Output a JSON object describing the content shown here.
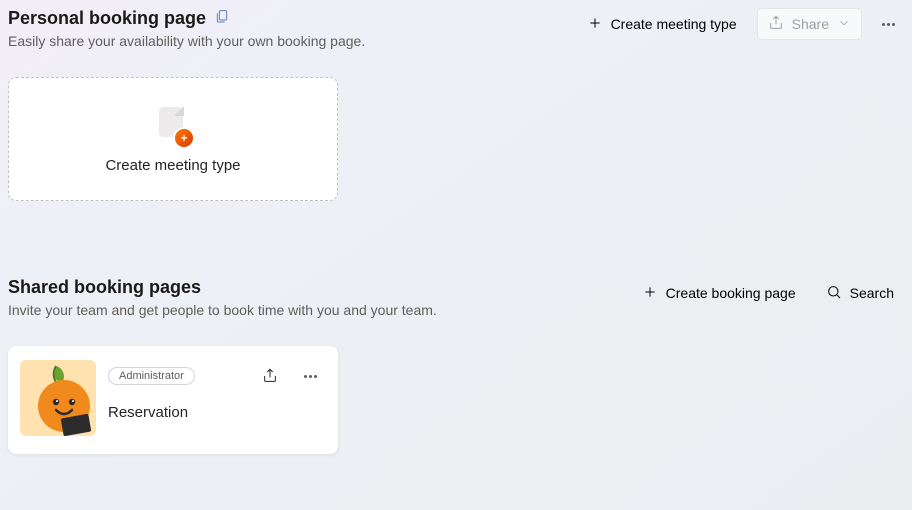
{
  "personal": {
    "title": "Personal booking page",
    "subtitle": "Easily share your availability with your own booking page.",
    "create_meeting_type_btn": "Create meeting type",
    "share_btn": "Share",
    "create_card_label": "Create meeting type"
  },
  "shared": {
    "title": "Shared booking pages",
    "subtitle": "Invite your team and get people to book time with you and your team.",
    "create_booking_page_btn": "Create booking page",
    "search_btn": "Search"
  },
  "cards": [
    {
      "role": "Administrator",
      "name": "Reservation"
    }
  ]
}
